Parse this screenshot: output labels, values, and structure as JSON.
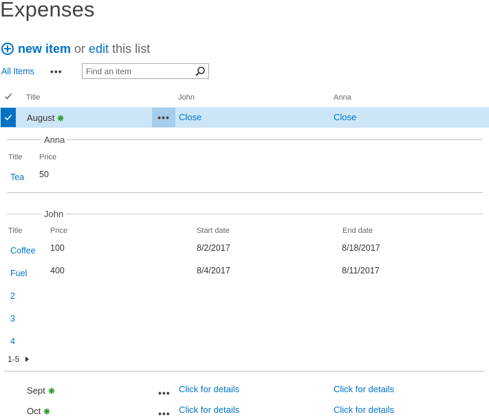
{
  "page": {
    "title": "Expenses"
  },
  "commands": {
    "new_item": "new item",
    "or": "or",
    "edit": "edit",
    "this_list": "this list"
  },
  "view": {
    "tab": "All Items",
    "more": "•••"
  },
  "search": {
    "placeholder": "Find an item"
  },
  "columns": {
    "title": "Title",
    "john": "John",
    "anna": "Anna"
  },
  "rows": [
    {
      "title": "August",
      "john": "Close",
      "anna": "Close",
      "selected": true,
      "is_new": true
    },
    {
      "title": "Sept",
      "john": "Click for details",
      "anna": "Click for details",
      "selected": false,
      "is_new": true
    },
    {
      "title": "Oct",
      "john": "Click for details",
      "anna": "Click for details",
      "selected": false,
      "is_new": true
    }
  ],
  "details": {
    "anna": {
      "label": "Anna",
      "headers": {
        "title": "Title",
        "price": "Price"
      },
      "items": [
        {
          "title": "Tea",
          "price": "50"
        }
      ]
    },
    "john": {
      "label": "John",
      "headers": {
        "title": "Title",
        "price": "Price",
        "start": "Start date",
        "end": "End date"
      },
      "items": [
        {
          "title": "Coffee",
          "price": "100",
          "start": "8/2/2017",
          "end": "8/18/2017"
        },
        {
          "title": "Fuel",
          "price": "400",
          "start": "8/4/2017",
          "end": "8/11/2017"
        }
      ],
      "pages": [
        "2",
        "3",
        "4"
      ],
      "range": "1-5"
    }
  },
  "colors": {
    "accent": "#0072c6",
    "selected_row": "#cde6f7",
    "new_star": "#2e9e2e"
  },
  "icons": {
    "new_item": "plus-circle-icon",
    "search": "search-icon",
    "check": "checkmark-icon",
    "new": "new-star-icon",
    "next": "chevron-right-icon"
  }
}
